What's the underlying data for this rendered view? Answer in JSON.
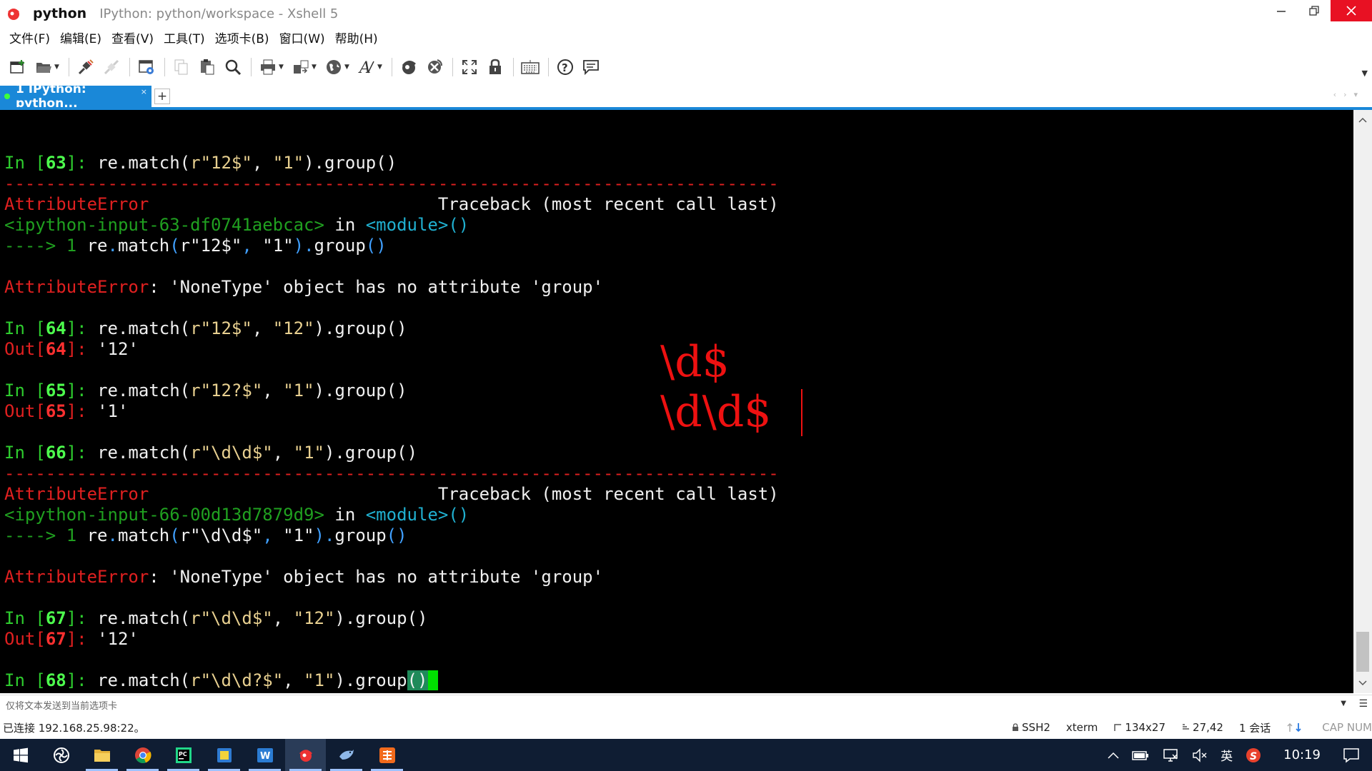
{
  "window": {
    "app_name": "python",
    "subtitle": "IPython: python/workspace - Xshell 5"
  },
  "menu": [
    "文件(F)",
    "编辑(E)",
    "查看(V)",
    "工具(T)",
    "选项卡(B)",
    "窗口(W)",
    "帮助(H)"
  ],
  "toolbar_icons": [
    "new-session-icon",
    "open-folder-icon",
    "connect-icon",
    "disconnect-icon",
    "properties-icon",
    "copy-icon",
    "paste-icon",
    "find-icon",
    "print-icon",
    "transfer-icon",
    "globe-icon",
    "font-icon",
    "xftp-icon",
    "xmanager-icon",
    "fullscreen-icon",
    "lock-icon",
    "keyboard-icon",
    "help-icon",
    "chat-icon"
  ],
  "tab": {
    "label": "1 IPython: python...",
    "close": "×",
    "add": "+"
  },
  "terminal": {
    "lines": [
      [],
      [
        {
          "t": "In ",
          "c": "#2ecc2e"
        },
        {
          "t": "[",
          "c": "#2ecc2e"
        },
        {
          "t": "63",
          "c": "#4dff4d",
          "b": true
        },
        {
          "t": "]: ",
          "c": "#2ecc2e"
        },
        {
          "t": "re.match(",
          "c": "#f0f0f0"
        },
        {
          "t": "r\"12$\"",
          "c": "#e8d090"
        },
        {
          "t": ", ",
          "c": "#f0f0f0"
        },
        {
          "t": "\"1\"",
          "c": "#e8d090"
        },
        {
          "t": ").group()",
          "c": "#f0f0f0"
        }
      ],
      [
        {
          "t": "---------------------------------------------------------------------------",
          "c": "#e02020"
        }
      ],
      [
        {
          "t": "AttributeError",
          "c": "#e02020"
        },
        {
          "t": "                            Traceback (most recent call last)",
          "c": "#f0f0f0"
        }
      ],
      [
        {
          "t": "<ipython-input-63-df0741aebcac>",
          "c": "#20a020"
        },
        {
          "t": " in ",
          "c": "#f0f0f0"
        },
        {
          "t": "<module>()",
          "c": "#20b0d0"
        }
      ],
      [
        {
          "t": "----> 1 ",
          "c": "#20a020"
        },
        {
          "t": "re",
          "c": "#f0f0f0"
        },
        {
          "t": ".",
          "c": "#40a0ff"
        },
        {
          "t": "match",
          "c": "#f0f0f0"
        },
        {
          "t": "(",
          "c": "#40a0ff"
        },
        {
          "t": "r\"12$\"",
          "c": "#f0f0f0"
        },
        {
          "t": ", ",
          "c": "#40a0ff"
        },
        {
          "t": "\"1\"",
          "c": "#f0f0f0"
        },
        {
          "t": ").",
          "c": "#40a0ff"
        },
        {
          "t": "group",
          "c": "#f0f0f0"
        },
        {
          "t": "()",
          "c": "#40a0ff"
        }
      ],
      [],
      [
        {
          "t": "AttributeError",
          "c": "#e02020"
        },
        {
          "t": ": 'NoneType' object has no attribute 'group'",
          "c": "#f0f0f0"
        }
      ],
      [],
      [
        {
          "t": "In ",
          "c": "#2ecc2e"
        },
        {
          "t": "[",
          "c": "#2ecc2e"
        },
        {
          "t": "64",
          "c": "#4dff4d",
          "b": true
        },
        {
          "t": "]: ",
          "c": "#2ecc2e"
        },
        {
          "t": "re.match(",
          "c": "#f0f0f0"
        },
        {
          "t": "r\"12$\"",
          "c": "#e8d090"
        },
        {
          "t": ", ",
          "c": "#f0f0f0"
        },
        {
          "t": "\"12\"",
          "c": "#e8d090"
        },
        {
          "t": ").group()",
          "c": "#f0f0f0"
        }
      ],
      [
        {
          "t": "Out",
          "c": "#e02020"
        },
        {
          "t": "[",
          "c": "#e02020"
        },
        {
          "t": "64",
          "c": "#ff3030",
          "b": true
        },
        {
          "t": "]: ",
          "c": "#e02020"
        },
        {
          "t": "'12'",
          "c": "#f0f0f0"
        }
      ],
      [],
      [
        {
          "t": "In ",
          "c": "#2ecc2e"
        },
        {
          "t": "[",
          "c": "#2ecc2e"
        },
        {
          "t": "65",
          "c": "#4dff4d",
          "b": true
        },
        {
          "t": "]: ",
          "c": "#2ecc2e"
        },
        {
          "t": "re.match(",
          "c": "#f0f0f0"
        },
        {
          "t": "r\"12?$\"",
          "c": "#e8d090"
        },
        {
          "t": ", ",
          "c": "#f0f0f0"
        },
        {
          "t": "\"1\"",
          "c": "#e8d090"
        },
        {
          "t": ").group()",
          "c": "#f0f0f0"
        }
      ],
      [
        {
          "t": "Out",
          "c": "#e02020"
        },
        {
          "t": "[",
          "c": "#e02020"
        },
        {
          "t": "65",
          "c": "#ff3030",
          "b": true
        },
        {
          "t": "]: ",
          "c": "#e02020"
        },
        {
          "t": "'1'",
          "c": "#f0f0f0"
        }
      ],
      [],
      [
        {
          "t": "In ",
          "c": "#2ecc2e"
        },
        {
          "t": "[",
          "c": "#2ecc2e"
        },
        {
          "t": "66",
          "c": "#4dff4d",
          "b": true
        },
        {
          "t": "]: ",
          "c": "#2ecc2e"
        },
        {
          "t": "re.match(",
          "c": "#f0f0f0"
        },
        {
          "t": "r\"\\d\\d$\"",
          "c": "#e8d090"
        },
        {
          "t": ", ",
          "c": "#f0f0f0"
        },
        {
          "t": "\"1\"",
          "c": "#e8d090"
        },
        {
          "t": ").group()",
          "c": "#f0f0f0"
        }
      ],
      [
        {
          "t": "---------------------------------------------------------------------------",
          "c": "#e02020"
        }
      ],
      [
        {
          "t": "AttributeError",
          "c": "#e02020"
        },
        {
          "t": "                            Traceback (most recent call last)",
          "c": "#f0f0f0"
        }
      ],
      [
        {
          "t": "<ipython-input-66-00d13d7879d9>",
          "c": "#20a020"
        },
        {
          "t": " in ",
          "c": "#f0f0f0"
        },
        {
          "t": "<module>()",
          "c": "#20b0d0"
        }
      ],
      [
        {
          "t": "----> 1 ",
          "c": "#20a020"
        },
        {
          "t": "re",
          "c": "#f0f0f0"
        },
        {
          "t": ".",
          "c": "#40a0ff"
        },
        {
          "t": "match",
          "c": "#f0f0f0"
        },
        {
          "t": "(",
          "c": "#40a0ff"
        },
        {
          "t": "r\"\\d\\d$\"",
          "c": "#f0f0f0"
        },
        {
          "t": ", ",
          "c": "#40a0ff"
        },
        {
          "t": "\"1\"",
          "c": "#f0f0f0"
        },
        {
          "t": ").",
          "c": "#40a0ff"
        },
        {
          "t": "group",
          "c": "#f0f0f0"
        },
        {
          "t": "()",
          "c": "#40a0ff"
        }
      ],
      [],
      [
        {
          "t": "AttributeError",
          "c": "#e02020"
        },
        {
          "t": ": 'NoneType' object has no attribute 'group'",
          "c": "#f0f0f0"
        }
      ],
      [],
      [
        {
          "t": "In ",
          "c": "#2ecc2e"
        },
        {
          "t": "[",
          "c": "#2ecc2e"
        },
        {
          "t": "67",
          "c": "#4dff4d",
          "b": true
        },
        {
          "t": "]: ",
          "c": "#2ecc2e"
        },
        {
          "t": "re.match(",
          "c": "#f0f0f0"
        },
        {
          "t": "r\"\\d\\d$\"",
          "c": "#e8d090"
        },
        {
          "t": ", ",
          "c": "#f0f0f0"
        },
        {
          "t": "\"12\"",
          "c": "#e8d090"
        },
        {
          "t": ").group()",
          "c": "#f0f0f0"
        }
      ],
      [
        {
          "t": "Out",
          "c": "#e02020"
        },
        {
          "t": "[",
          "c": "#e02020"
        },
        {
          "t": "67",
          "c": "#ff3030",
          "b": true
        },
        {
          "t": "]: ",
          "c": "#e02020"
        },
        {
          "t": "'12'",
          "c": "#f0f0f0"
        }
      ],
      [],
      [
        {
          "t": "In ",
          "c": "#2ecc2e"
        },
        {
          "t": "[",
          "c": "#2ecc2e"
        },
        {
          "t": "68",
          "c": "#4dff4d",
          "b": true
        },
        {
          "t": "]: ",
          "c": "#2ecc2e"
        },
        {
          "t": "re.match(",
          "c": "#f0f0f0"
        },
        {
          "t": "r\"\\d\\d?$\"",
          "c": "#e8d090"
        },
        {
          "t": ", ",
          "c": "#f0f0f0"
        },
        {
          "t": "\"1\"",
          "c": "#e8d090"
        },
        {
          "t": ").group",
          "c": "#f0f0f0"
        },
        {
          "t": "()",
          "c": "#f0f0f0",
          "bg": "#1f8a5a"
        },
        {
          "t": " ",
          "bg": "#00e000"
        }
      ]
    ]
  },
  "annotation": {
    "line1": "\\d$",
    "line2": "\\d\\d$"
  },
  "compose_bar": {
    "text": "仅将文本发送到当前选项卡"
  },
  "status": {
    "connection": "已连接 192.168.25.98:22。",
    "protocol": "SSH2",
    "term_type": "xterm",
    "size": "134x27",
    "cursor": "27,42",
    "sessions": "1 会话",
    "caps": "CAP NUM"
  },
  "taskbar": {
    "apps": [
      "windows-start-icon",
      "pinwheel-app-icon",
      "file-explorer-icon",
      "chrome-icon",
      "pycharm-icon",
      "notes-app-icon",
      "word-icon",
      "xshell-icon",
      "bird-app-icon",
      "orange-app-icon"
    ],
    "tray": {
      "ime": "英",
      "time": "10:19"
    }
  }
}
